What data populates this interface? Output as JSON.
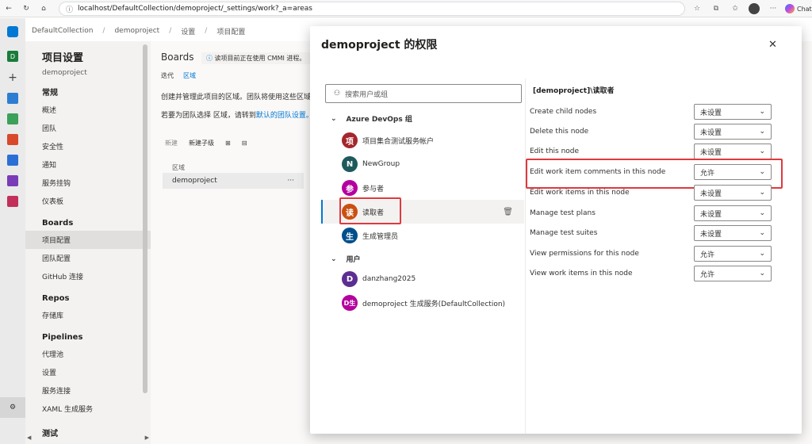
{
  "browser": {
    "url": "localhost/DefaultCollection/demoproject/_settings/work?_a=areas",
    "chat_label": "Chat"
  },
  "breadcrumb": [
    "DefaultCollection",
    "demoproject",
    "设置",
    "项目配置"
  ],
  "rail": {
    "org_initial": "D",
    "add": "+"
  },
  "sidebar": {
    "title": "项目设置",
    "project": "demoproject",
    "sections": [
      {
        "heading": "常规",
        "items": [
          "概述",
          "团队",
          "安全性",
          "通知",
          "服务挂钩",
          "仪表板"
        ]
      },
      {
        "heading": "Boards",
        "items": [
          "项目配置",
          "团队配置",
          "GitHub 连接"
        ]
      },
      {
        "heading": "Repos",
        "items": [
          "存储库"
        ]
      },
      {
        "heading": "Pipelines",
        "items": [
          "代理池",
          "设置",
          "服务连接",
          "XAML 生成服务"
        ]
      },
      {
        "heading": "测试",
        "items": []
      }
    ],
    "active_item": "项目配置"
  },
  "content": {
    "title": "Boards",
    "notice": "读项目前正在使用 CMMI 进程。",
    "tabs": [
      "迭代",
      "区域"
    ],
    "active_tab": "区域",
    "line1": "创建并管理此项目的区域。团队将使用这些区域",
    "line2_prefix": "若要为团队选择 区域，请转到",
    "line2_link": "默认的团队设置。",
    "toolbar": {
      "new": "新建",
      "new_child": "新建子级",
      "expand": "⊞",
      "collapse": "⊟"
    },
    "column": "区域",
    "row": "demoproject",
    "row_more": "···"
  },
  "dialog": {
    "title": "demoproject 的权限",
    "close": "✕",
    "search_placeholder": "搜索用户或组",
    "groups_heading": "Azure DevOps 组",
    "groups": [
      {
        "initial": "项",
        "name": "项目集合测试服务帐户",
        "color": "#a4262c"
      },
      {
        "initial": "N",
        "name": "NewGroup",
        "color": "#1e5a5c"
      },
      {
        "initial": "参",
        "name": "参与者",
        "color": "#b4009e"
      },
      {
        "initial": "读",
        "name": "读取者",
        "color": "#ca5010"
      },
      {
        "initial": "生",
        "name": "生成管理员",
        "color": "#004e8c"
      }
    ],
    "users_heading": "用户",
    "users": [
      {
        "initial": "D",
        "name": "danzhang2025",
        "color": "#5c2e91"
      },
      {
        "initial": "D生",
        "name": "demoproject 生成服务(DefaultCollection)",
        "color": "#b4009e"
      }
    ],
    "selected_identity": "读取者",
    "permissions_heading": "[demoproject]\\读取者",
    "permissions": [
      {
        "label": "Create child nodes",
        "value": "未设置"
      },
      {
        "label": "Delete this node",
        "value": "未设置"
      },
      {
        "label": "Edit this node",
        "value": "未设置"
      },
      {
        "label": "Edit work item comments in this node",
        "value": "允许"
      },
      {
        "label": "Edit work items in this node",
        "value": "未设置"
      },
      {
        "label": "Manage test plans",
        "value": "未设置"
      },
      {
        "label": "Manage test suites",
        "value": "未设置"
      },
      {
        "label": "View permissions for this node",
        "value": "允许"
      },
      {
        "label": "View work items in this node",
        "value": "允许"
      }
    ]
  },
  "colors": {
    "accent": "#0078d4",
    "highlight_red": "#e0393e"
  }
}
